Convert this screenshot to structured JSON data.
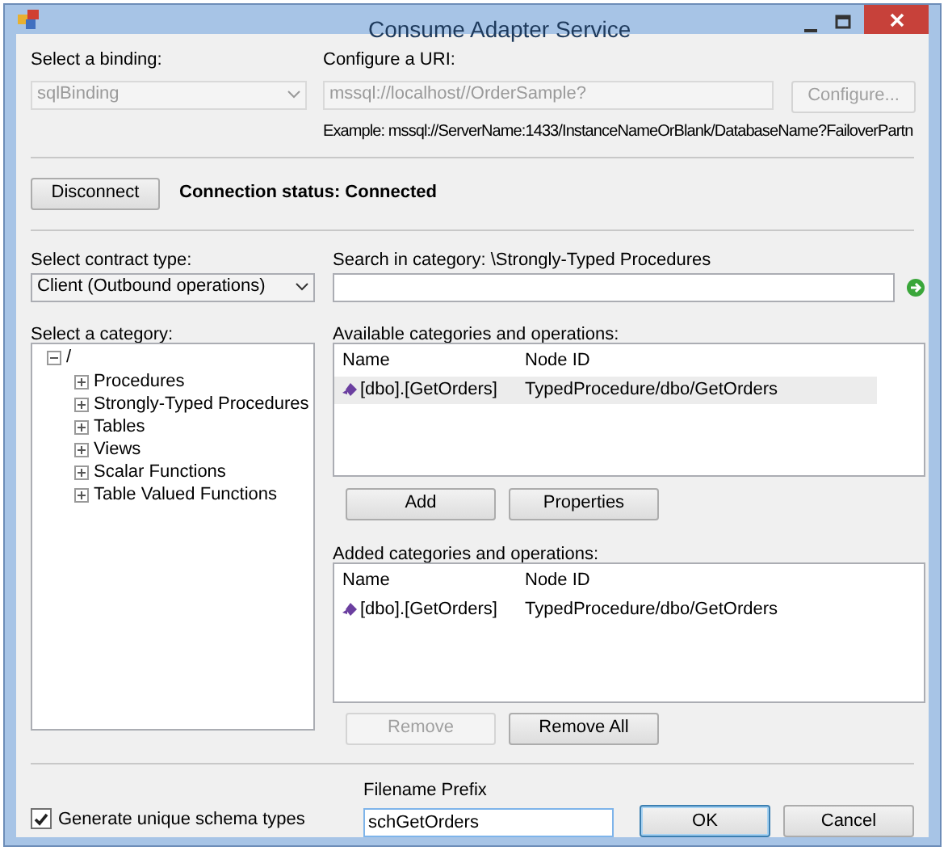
{
  "window": {
    "title": "Consume Adapter Service"
  },
  "binding": {
    "label": "Select a binding:",
    "value": "sqlBinding",
    "disabled": true
  },
  "uri": {
    "label": "Configure a URI:",
    "value": "mssql://localhost//OrderSample?",
    "disabled": true
  },
  "configure_button": {
    "label": "Configure...",
    "disabled": true
  },
  "example": "Example: mssql://ServerName:1433/InstanceNameOrBlank/DatabaseName?FailoverPartn",
  "disconnect_button": {
    "label": "Disconnect",
    "disabled": false
  },
  "connection_status": "Connection status: Connected",
  "contract_type": {
    "label": "Select contract type:",
    "value": "Client (Outbound operations)"
  },
  "search": {
    "label": "Search in category: \\Strongly-Typed Procedures"
  },
  "category": {
    "label": "Select a category:",
    "tree": [
      {
        "label": "/",
        "expanded": true,
        "children": [
          {
            "label": "Procedures",
            "expanded": false
          },
          {
            "label": "Strongly-Typed Procedures",
            "expanded": false
          },
          {
            "label": "Tables",
            "expanded": false
          },
          {
            "label": "Views",
            "expanded": false
          },
          {
            "label": "Scalar Functions",
            "expanded": false
          },
          {
            "label": "Table Valued Functions",
            "expanded": false
          }
        ]
      }
    ]
  },
  "available": {
    "label": "Available categories and operations:",
    "columns": [
      "Name",
      "Node ID"
    ],
    "rows": [
      {
        "name": "[dbo].[GetOrders]",
        "node_id": "TypedProcedure/dbo/GetOrders",
        "selected": true
      }
    ]
  },
  "available_buttons": [
    {
      "label": "Add",
      "disabled": false
    },
    {
      "label": "Properties",
      "disabled": false
    }
  ],
  "added": {
    "label": "Added categories and operations:",
    "columns": [
      "Name",
      "Node ID"
    ],
    "rows": [
      {
        "name": "[dbo].[GetOrders]",
        "node_id": "TypedProcedure/dbo/GetOrders",
        "selected": false
      }
    ]
  },
  "added_buttons": [
    {
      "label": "Remove",
      "disabled": true
    },
    {
      "label": "Remove All",
      "disabled": false
    }
  ],
  "generate_unique": {
    "label": "Generate unique schema types",
    "checked": true
  },
  "filename_prefix": {
    "label": "Filename Prefix",
    "value": "schGetOrders"
  },
  "dialog_buttons": [
    {
      "label": "OK",
      "default": true
    },
    {
      "label": "Cancel",
      "default": false
    }
  ]
}
